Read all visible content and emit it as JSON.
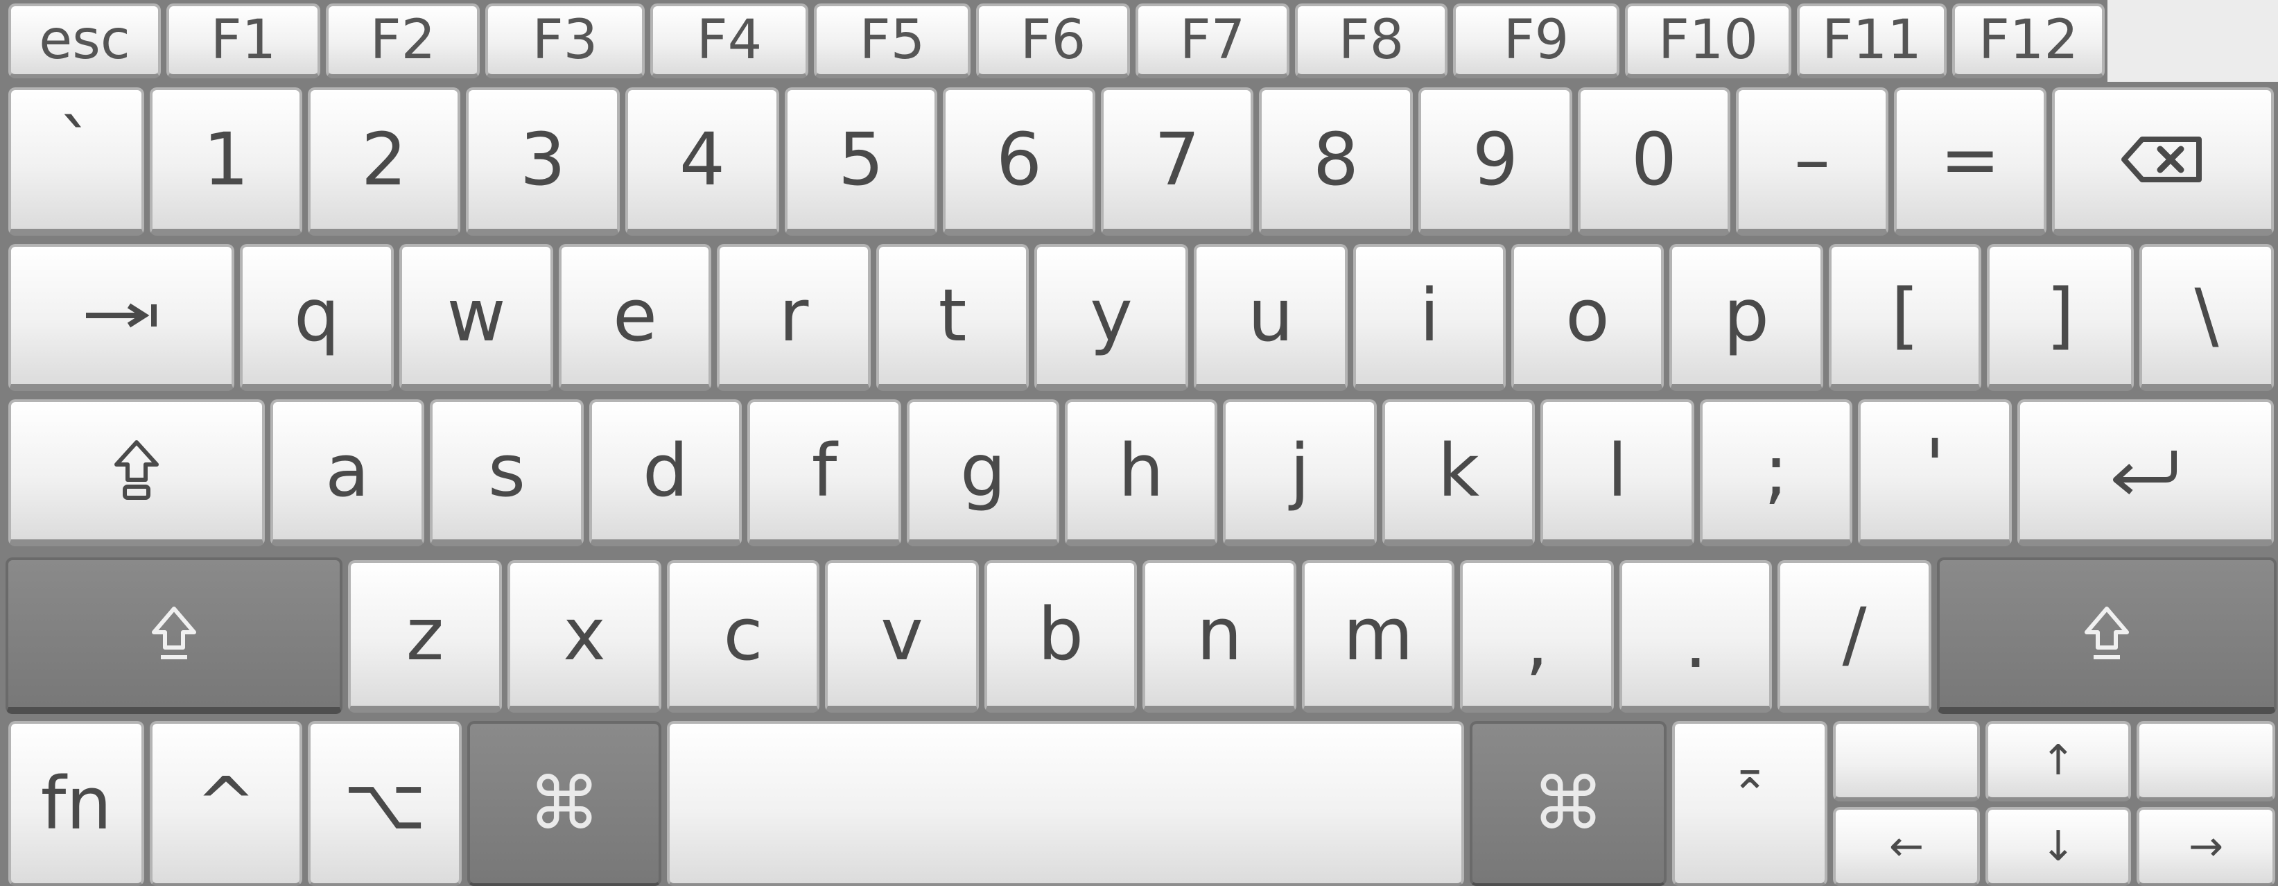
{
  "function_row": [
    "esc",
    "F1",
    "F2",
    "F3",
    "F4",
    "F5",
    "F6",
    "F7",
    "F8",
    "F9",
    "F10",
    "F11",
    "F12"
  ],
  "number_row": [
    "`",
    "1",
    "2",
    "3",
    "4",
    "5",
    "6",
    "7",
    "8",
    "9",
    "0",
    "–",
    "="
  ],
  "qwerty_row": [
    "q",
    "w",
    "e",
    "r",
    "t",
    "y",
    "u",
    "i",
    "o",
    "p",
    "[",
    "]",
    "\\"
  ],
  "home_row": [
    "a",
    "s",
    "d",
    "f",
    "g",
    "h",
    "j",
    "k",
    "l",
    ";",
    "'"
  ],
  "shift_row": [
    "z",
    "x",
    "c",
    "v",
    "b",
    "n",
    "m",
    ",",
    ".",
    "/"
  ],
  "bottom_row": {
    "fn": "fn",
    "control": "^",
    "option": "⌥",
    "command_left": "⌘",
    "command_right": "⌘",
    "eject_label": "⌅"
  },
  "arrows": {
    "up": "↑",
    "left": "←",
    "down": "↓",
    "right": "→"
  },
  "icons": {
    "delete": "delete-icon",
    "tab": "tab-icon",
    "caps_lock": "caps-lock-icon",
    "return": "return-icon",
    "shift": "shift-icon"
  }
}
